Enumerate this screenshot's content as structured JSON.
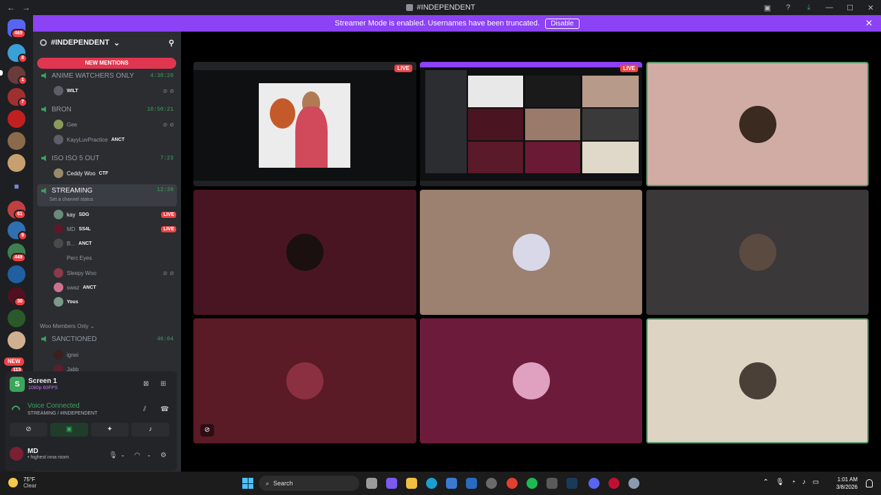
{
  "window": {
    "title": "#INDEPENDENT"
  },
  "banner": {
    "text": "Streamer Mode is enabled. Usernames have been truncated.",
    "button": "Disable"
  },
  "rail": {
    "badges": [
      "465",
      "8",
      "1",
      "7",
      "61",
      "9",
      "449",
      "30",
      "NEW",
      "113"
    ]
  },
  "server": {
    "name": "#INDEPENDENT",
    "new_mentions": "NEW MENTIONS"
  },
  "channels": [
    {
      "name": "ANIME WATCHERS ONLY",
      "time": "4:38:20"
    },
    {
      "name": "BRON",
      "time": "10:50:21"
    },
    {
      "name": "ISO ISO 5 OUT",
      "time": "7:23"
    },
    {
      "name": "STREAMING",
      "time": "12:39",
      "status": "Set a channel status"
    },
    {
      "name": "SANCTIONED",
      "time": "46:04"
    }
  ],
  "members": {
    "anime": [
      {
        "name": "WILT"
      }
    ],
    "bron": [
      {
        "name": "Gee"
      },
      {
        "name": "KayyLuvPractice",
        "tag": "ANCT"
      }
    ],
    "iso": [
      {
        "name": "Ceddy Woo",
        "tag": "CTF"
      }
    ],
    "streaming": [
      {
        "name": "kay",
        "tag": "SDG",
        "live": "LIVE"
      },
      {
        "name": "MD",
        "tag": "SS4L",
        "live": "LIVE"
      },
      {
        "name": "B...",
        "tag": "ANCT"
      },
      {
        "name": "Perc Eyes"
      },
      {
        "name": "Sleepy Woo"
      },
      {
        "name": "swaz",
        "tag": "ANCT"
      },
      {
        "name": "Yous"
      }
    ],
    "sanctioned": [
      {
        "name": "ignei"
      },
      {
        "name": "Jabb"
      }
    ]
  },
  "category": "Woo Members Only",
  "panel": {
    "screen_title": "Screen 1",
    "screen_sub": "1080p 60FPS",
    "voice_connected": "Voice Connected",
    "voice_sub": "STREAMING / #INDEPENDENT",
    "user_name": "MD",
    "user_status": "• highest inna room"
  },
  "grid": {
    "live_label": "LIVE"
  },
  "taskbar": {
    "temp": "75°F",
    "condition": "Clear",
    "search": "Search",
    "time": "1:01 AM",
    "date": "3/8/2026"
  },
  "colors": {
    "accent": "#8c42f5",
    "green": "#3ba55d",
    "live": "#ed4245"
  }
}
